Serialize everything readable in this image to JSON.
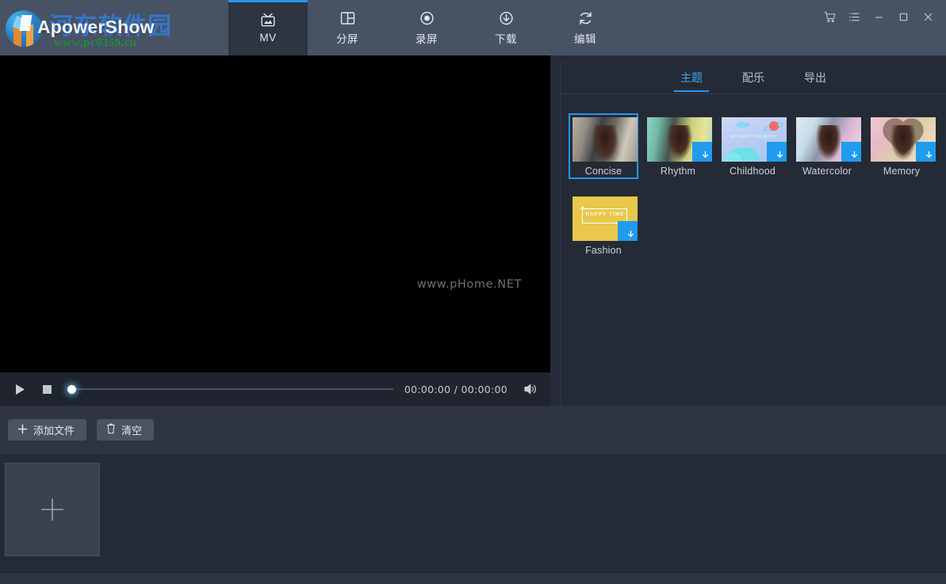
{
  "app": {
    "brand": "ApowerShow",
    "watermark_cn": "河东软件园",
    "watermark_url": "www.pc0359.cn",
    "accent_color": "#2196f3",
    "topbar_color": "#475264",
    "panel_color": "#252b36"
  },
  "nav": {
    "tabs": [
      {
        "label": "MV",
        "icon": "tv-icon",
        "active": true
      },
      {
        "label": "分屏",
        "icon": "split-screen-icon",
        "active": false
      },
      {
        "label": "录屏",
        "icon": "record-icon",
        "active": false
      },
      {
        "label": "下载",
        "icon": "download-icon",
        "active": false
      },
      {
        "label": "编辑",
        "icon": "edit-refresh-icon",
        "active": false
      }
    ]
  },
  "window_controls": {
    "cart": "cart-icon",
    "menu": "list-menu-icon",
    "minimize": "minimize-icon",
    "maximize": "maximize-icon",
    "close": "close-icon"
  },
  "preview": {
    "watermark": "www.pHome.NET"
  },
  "player": {
    "play_label": "play",
    "stop_label": "stop",
    "time": "00:00:00 / 00:00:00",
    "progress_percent": 0,
    "volume_label": "volume"
  },
  "toolbar": {
    "add_file_label": "添加文件",
    "clear_label": "清空"
  },
  "timeline": {
    "add_placeholder": "+"
  },
  "right_panel": {
    "tabs": [
      {
        "label": "主题",
        "active": true
      },
      {
        "label": "配乐",
        "active": false
      },
      {
        "label": "导出",
        "active": false
      }
    ],
    "themes": [
      {
        "label": "Concise",
        "art": "th-concise",
        "selected": true,
        "downloadable": false
      },
      {
        "label": "Rhythm",
        "art": "th-rhythm",
        "selected": false,
        "downloadable": true
      },
      {
        "label": "Childhood",
        "art": "th-childhood",
        "selected": false,
        "downloadable": true
      },
      {
        "label": "Watercolor",
        "art": "th-watercolor",
        "selected": false,
        "downloadable": true
      },
      {
        "label": "Memory",
        "art": "th-memory",
        "selected": false,
        "downloadable": true
      },
      {
        "label": "Fashion",
        "art": "th-fashion",
        "selected": false,
        "downloadable": true
      }
    ],
    "childhood_caption": "MY HAPPY MEMORY",
    "fashion_caption": "HAPPY TIME"
  }
}
